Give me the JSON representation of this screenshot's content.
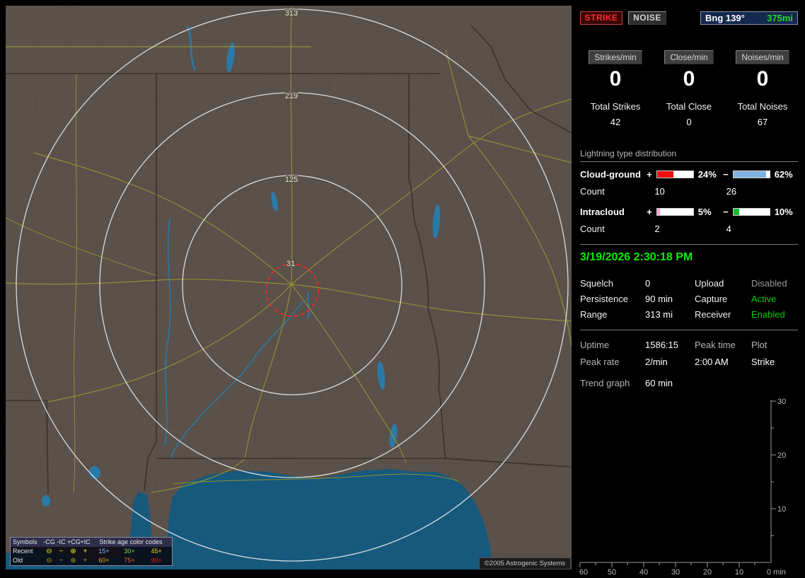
{
  "map": {
    "ring_labels": [
      "313",
      "219",
      "125",
      "31"
    ],
    "copyright": "©2005 Astrogenic Systems",
    "colors": {
      "land": "#5a514b",
      "water": "#16597c",
      "roads": "#8f8f35",
      "range_ring": "#eeeeee",
      "alarm_ring": "#ff2222"
    },
    "legend": {
      "symbols_header": "Symbols",
      "type_headers": [
        "-CG",
        "-IC",
        "+CG",
        "+IC"
      ],
      "age_header": "Strike age color codes",
      "rows": [
        {
          "label": "Recent",
          "symbols": [
            "⊖",
            "−",
            "⊕",
            "+"
          ],
          "symbol_color": "#e8e820",
          "ages": [
            {
              "label": "15+",
              "color": "#8cb4ff"
            },
            {
              "label": "30+",
              "color": "#86d44a"
            },
            {
              "label": "45+",
              "color": "#e8d428"
            }
          ]
        },
        {
          "label": "Old",
          "symbols": [
            "⊖",
            "−",
            "⊕",
            "+"
          ],
          "symbol_color": "#a89818",
          "ages": [
            {
              "label": "60+",
              "color": "#e8a020"
            },
            {
              "label": "75+",
              "color": "#e86018"
            },
            {
              "label": "90+",
              "color": "#e82010"
            }
          ]
        }
      ]
    }
  },
  "side": {
    "strike_button": "STRIKE",
    "noise_button": "NOISE",
    "bearing": "Bng 139°",
    "bearing_range": "375mi",
    "stats": [
      {
        "rate_label": "Strikes/min",
        "rate": "0",
        "total_label": "Total Strikes",
        "total": "42"
      },
      {
        "rate_label": "Close/min",
        "rate": "0",
        "total_label": "Total Close",
        "total": "0"
      },
      {
        "rate_label": "Noises/min",
        "rate": "0",
        "total_label": "Total Noises",
        "total": "67"
      }
    ],
    "distribution": {
      "header": "Lightning type distribution",
      "count_label": "Count",
      "rows": [
        {
          "label": "Cloud-ground",
          "plus": "+",
          "minus": "−",
          "pos_pct": "24%",
          "neg_pct": "62%",
          "pos_fill": 46,
          "neg_fill": 90,
          "pos_color": "#ee1010",
          "neg_color": "#7fb2e0",
          "pos_count": "10",
          "neg_count": "26"
        },
        {
          "label": "Intracloud",
          "plus": "+",
          "minus": "−",
          "pos_pct": "5%",
          "neg_pct": "10%",
          "pos_fill": 8,
          "neg_fill": 16,
          "pos_color": "#f0a0c8",
          "neg_color": "#10c030",
          "pos_count": "2",
          "neg_count": "4"
        }
      ]
    },
    "timestamp": "3/19/2026 2:30:18 PM",
    "settings": [
      {
        "label": "Squelch",
        "value": "0",
        "label2": "Upload",
        "value2": "Disabled",
        "value2_color": "#9a9a9a"
      },
      {
        "label": "Persistence",
        "value": "90 min",
        "label2": "Capture",
        "value2": "Active",
        "value2_color": "#00cc00"
      },
      {
        "label": "Range",
        "value": "313 mi",
        "label2": "Receiver",
        "value2": "Enabled",
        "value2_color": "#00cc00"
      }
    ],
    "status": {
      "uptime_label": "Uptime",
      "uptime": "1586:15",
      "peak_time_label": "Peak time",
      "plot_label": "Plot",
      "peak_rate_label": "Peak rate",
      "peak_rate": "2/min",
      "peak_time": "2:00 AM",
      "plot": "Strike",
      "trend_label": "Trend graph",
      "trend_window": "60 min"
    },
    "trend_graph": {
      "type": "line",
      "series": [],
      "x_ticks": [
        "60",
        "50",
        "40",
        "30",
        "20",
        "10"
      ],
      "origin_label": "0 min",
      "y_ticks": [
        "30",
        "20",
        "10"
      ],
      "y_range": [
        0,
        30
      ],
      "x_range_minutes": [
        60,
        0
      ]
    }
  }
}
